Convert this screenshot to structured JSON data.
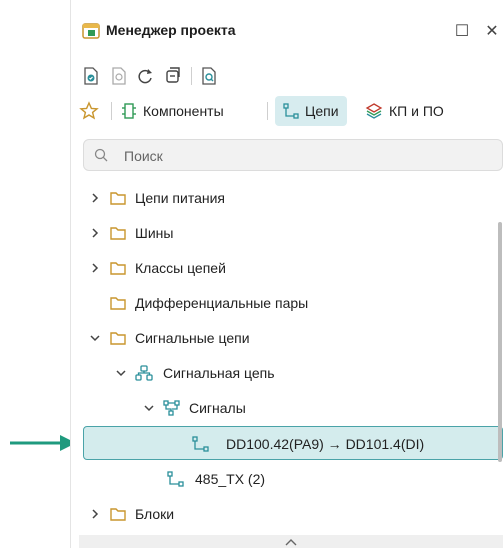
{
  "window": {
    "title": "Менеджер проекта",
    "maximize_glyph": "☐",
    "close_glyph": "✕"
  },
  "toolbar": {
    "icons": [
      "document-report-icon",
      "document-preview-icon",
      "refresh-icon",
      "copy-window-icon",
      "search-doc-icon"
    ]
  },
  "tabs": [
    {
      "label": "",
      "icon": "star-icon"
    },
    {
      "label": "Компоненты",
      "icon": "component-icon"
    },
    {
      "label": "Цепи",
      "icon": "net-icon",
      "active": true
    },
    {
      "label": "КП и ПО",
      "icon": "layers-icon"
    }
  ],
  "search": {
    "placeholder": "Поиск",
    "value": ""
  },
  "tree": [
    {
      "label": "Цепи питания",
      "expanded": false
    },
    {
      "label": "Шины",
      "expanded": false
    },
    {
      "label": "Классы цепей",
      "expanded": false
    },
    {
      "label": "Дифференциальные пары",
      "expanded": null
    },
    {
      "label": "Сигнальные цепи",
      "expanded": true
    },
    {
      "label": "Сигнальная цепь",
      "expanded": true
    },
    {
      "label": "Сигналы",
      "expanded": true
    },
    {
      "label": "DD100.42(PA9) → DD101.4(DI)",
      "selected": true
    },
    {
      "label": "485_TX (2)"
    },
    {
      "label": "Блоки",
      "expanded": false
    }
  ],
  "colors": {
    "accent": "#4aa3a8",
    "selected_bg": "#d4eced",
    "pointer_arrow": "#1f9a7e",
    "folder": "#c9962e",
    "net_icon": "#2a8f9a"
  }
}
